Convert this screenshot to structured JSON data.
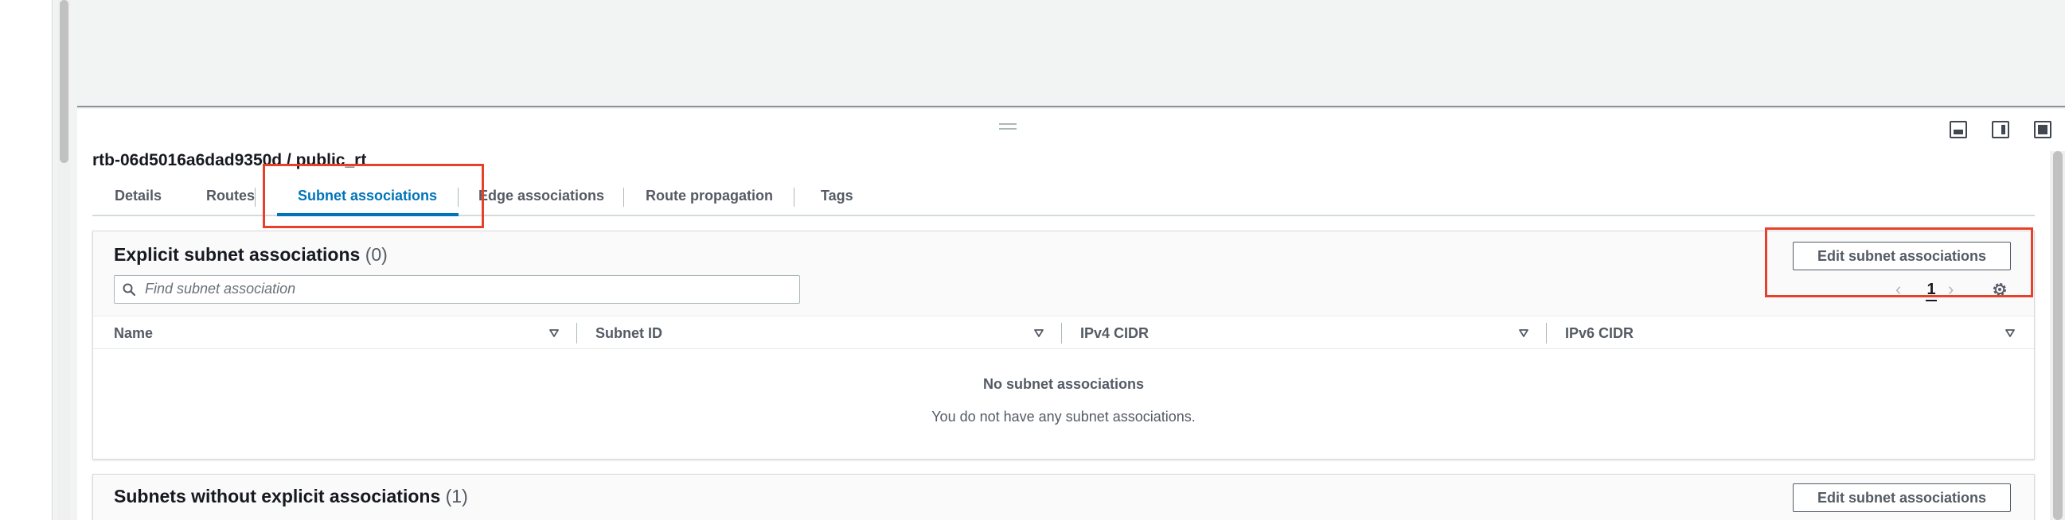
{
  "panel": {
    "title": "rtb-06d5016a6dad9350d / public_rt"
  },
  "tabs": [
    {
      "label": "Details"
    },
    {
      "label": "Routes"
    },
    {
      "label": "Subnet associations"
    },
    {
      "label": "Edge associations"
    },
    {
      "label": "Route propagation"
    },
    {
      "label": "Tags"
    }
  ],
  "explicit": {
    "title": "Explicit subnet associations",
    "count": "(0)",
    "edit_label": "Edit subnet associations",
    "search_placeholder": "Find subnet association",
    "page": "1",
    "columns": [
      "Name",
      "Subnet ID",
      "IPv4 CIDR",
      "IPv6 CIDR"
    ],
    "empty_title": "No subnet associations",
    "empty_desc": "You do not have any subnet associations."
  },
  "without": {
    "title": "Subnets without explicit associations",
    "count": "(1)",
    "edit_label": "Edit subnet associations"
  },
  "colors": {
    "active_tab": "#0073bb",
    "highlight": "#e8412b"
  }
}
